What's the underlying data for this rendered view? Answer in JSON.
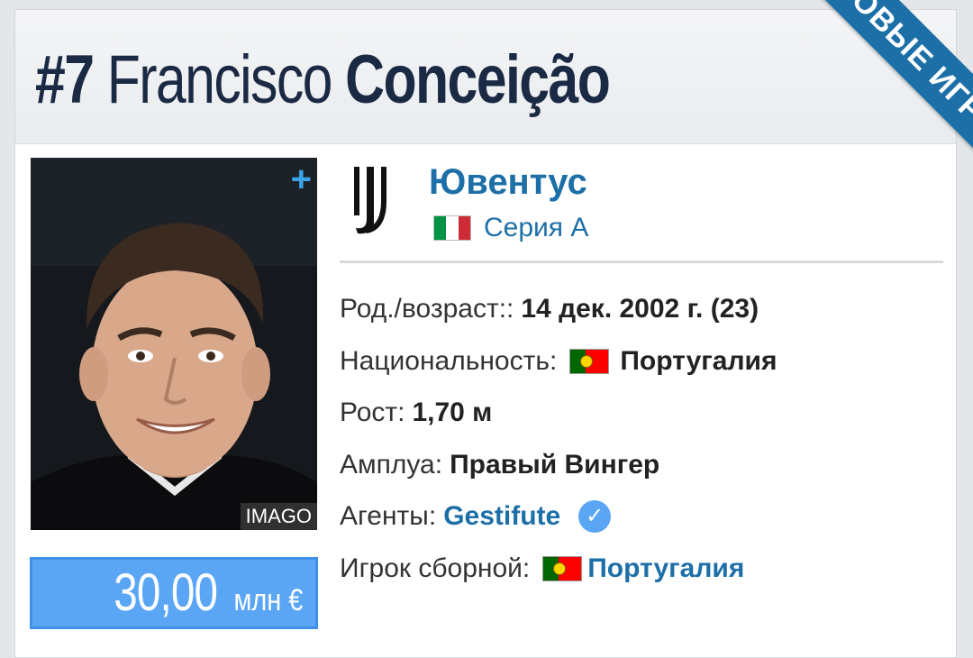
{
  "header": {
    "number": "#7",
    "first_name": "Francisco",
    "last_name": "Conceição"
  },
  "ribbon": {
    "label": "НОВЫЕ ИГРОКИ"
  },
  "photo": {
    "credit": "IMAGO",
    "add_symbol": "+"
  },
  "market_value": {
    "amount": "30,00",
    "unit": "млн €"
  },
  "club": {
    "name": "Ювентус",
    "league": "Серия A",
    "league_flag": [
      "#009246",
      "#ffffff",
      "#ce2b37"
    ]
  },
  "details": {
    "birth": {
      "label": "Род./возраст::",
      "value": "14 дек. 2002 г. (23)"
    },
    "nationality": {
      "label": "Национальность:",
      "value": "Португалия"
    },
    "height": {
      "label": "Рост:",
      "value": "1,70 м"
    },
    "position": {
      "label": "Амплуа:",
      "value": "Правый Вингер"
    },
    "agents": {
      "label": "Агенты:",
      "value": "Gestifute"
    },
    "national_player": {
      "label": "Игрок сборной:",
      "value": "Португалия"
    }
  },
  "colors": {
    "accent": "#1d6fa8",
    "title": "#1a2a44",
    "value_box": "#5aa6f5"
  }
}
